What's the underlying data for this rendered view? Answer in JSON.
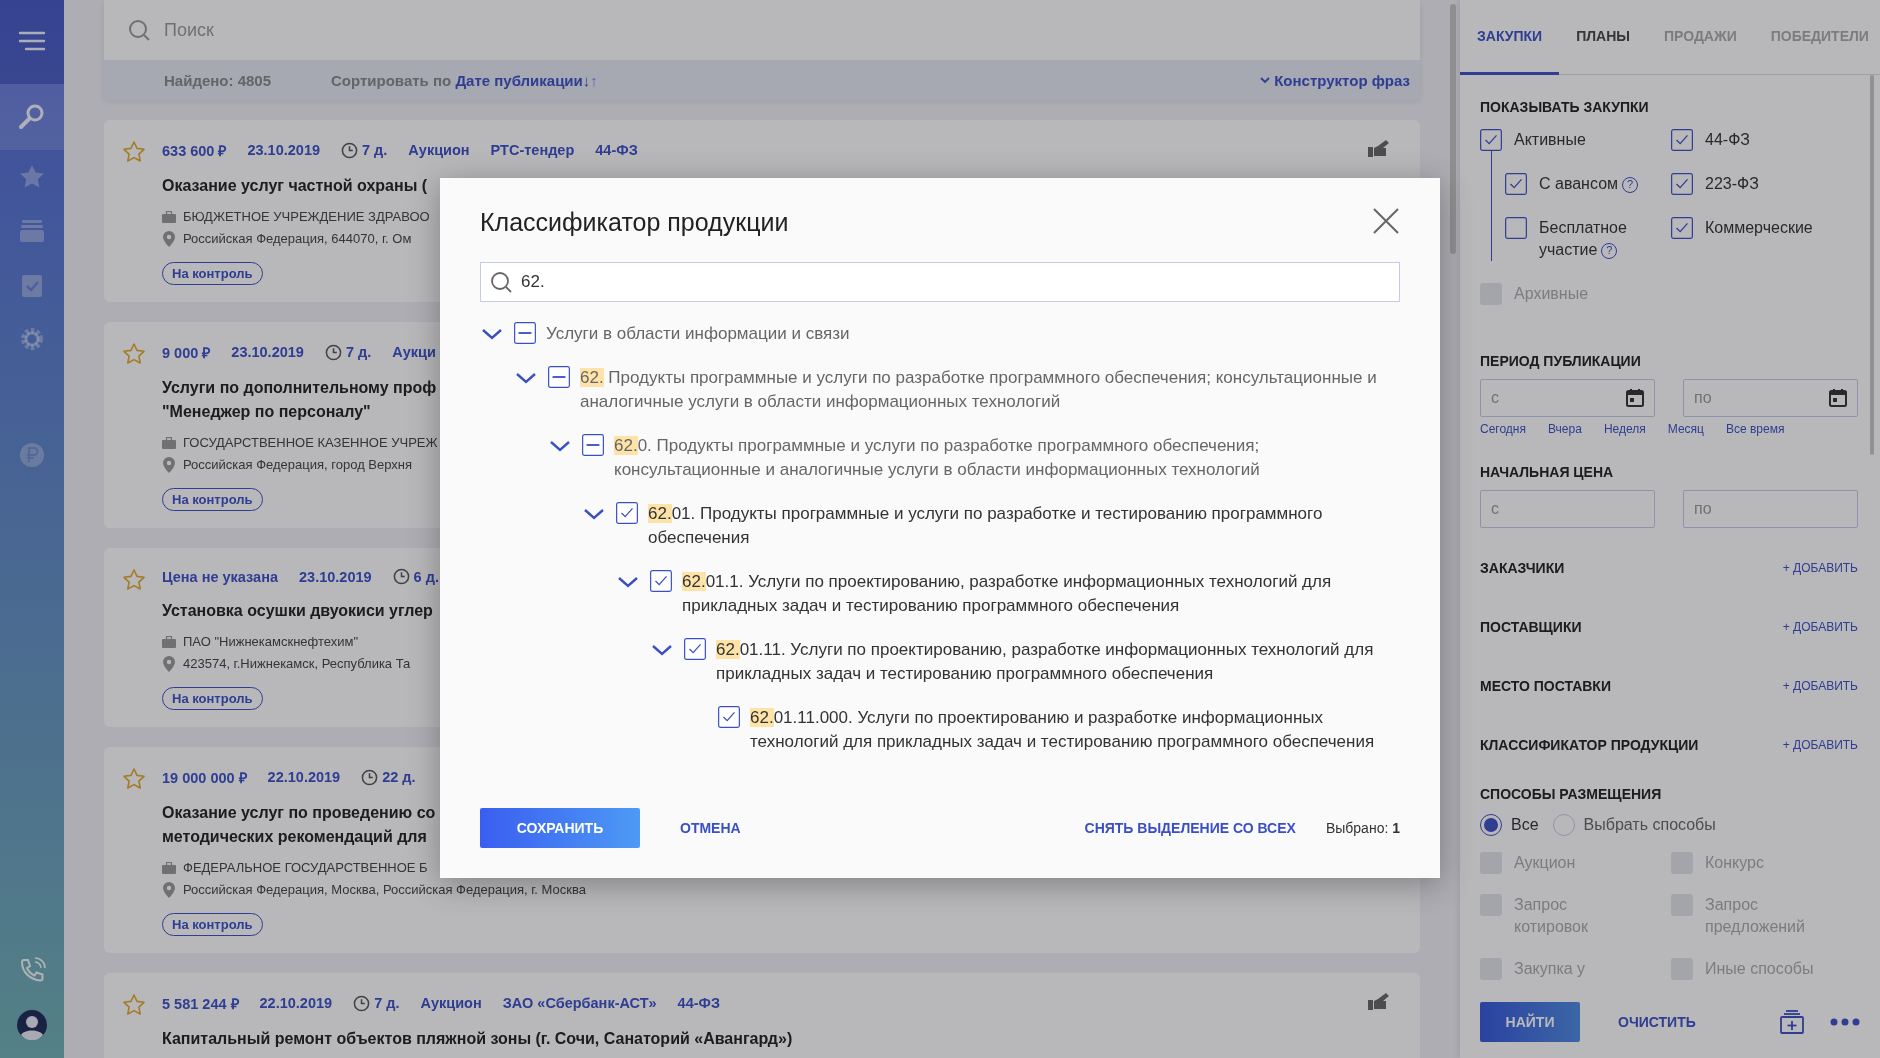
{
  "nav": [
    {
      "kind": "menu",
      "selected": false
    },
    {
      "kind": "search",
      "selected": true
    },
    {
      "kind": "star",
      "selected": false
    },
    {
      "kind": "stack",
      "selected": false
    },
    {
      "kind": "clipboard",
      "selected": false
    },
    {
      "kind": "gear",
      "selected": false
    },
    {
      "kind": "ruble",
      "selected": false
    },
    {
      "kind": "phone",
      "selected": false
    },
    {
      "kind": "avatar",
      "selected": false
    }
  ],
  "search": {
    "placeholder": "Поиск"
  },
  "results_bar": {
    "found": "Найдено: 4805",
    "sort_label": "Сортировать по",
    "sort_value": "Дате публикации↓",
    "sort_alt": "↑",
    "phrase_builder": "Конструктор фраз"
  },
  "cards": [
    {
      "starred": false,
      "price": "633 600 ₽",
      "date": "23.10.2019",
      "days": "7 д.",
      "tags": [
        "Аукцион",
        "РТС-тендер",
        "44-ФЗ"
      ],
      "title_lines": [
        "Оказание услуг частной охраны ("
      ],
      "org": "БЮДЖЕТНОЕ УЧРЕЖДЕНИЕ ЗДРАВОО",
      "address": "Российская Федерация, 644070, г. Ом",
      "button": "На контроль",
      "action_icon": true
    },
    {
      "starred": false,
      "price": "9 000 ₽",
      "date": "23.10.2019",
      "days": "7 д.",
      "tags": [
        "Аукци"
      ],
      "title_lines": [
        "Услуги по дополнительному проф",
        "\"Менеджер по персоналу\""
      ],
      "org": "ГОСУДАРСТВЕННОЕ КАЗЕННОЕ УЧРЕЖ",
      "address": "Российская Федерация, город Верхня",
      "button": "На контроль",
      "action_icon": false
    },
    {
      "starred": false,
      "price": "Цена не указана",
      "date": "23.10.2019",
      "days": "6 д.",
      "title_lines": [
        "Установка осушки двуокиси углер"
      ],
      "org": "ПАО \"Нижнекамскнефтехим\"",
      "address": "423574, г.Нижнекамск, Республика Та",
      "button": "На контроль",
      "action_icon": false
    },
    {
      "starred": false,
      "price": "19 000 000 ₽",
      "date": "22.10.2019",
      "days": "22 д.",
      "title_lines": [
        "Оказание услуг по проведению со",
        "методических рекомендаций для"
      ],
      "org": "ФЕДЕРАЛЬНОЕ ГОСУДАРСТВЕННОЕ Б",
      "address": "Российская Федерация, Москва, Российская Федерация, г. Москва",
      "button": "На контроль",
      "action_icon": false
    },
    {
      "starred": false,
      "price": "5 581 244 ₽",
      "date": "22.10.2019",
      "days": "7 д.",
      "tags": [
        "Аукцион",
        "ЗАО «Сбербанк-АСТ»",
        "44-ФЗ"
      ],
      "title_lines": [
        "Капитальный ремонт объектов пляжной зоны (г. Сочи, Санаторий «Авангард»)"
      ],
      "action_icon": true
    }
  ],
  "filters": {
    "tabs": [
      {
        "label": "ЗАКУПКИ",
        "selected": true,
        "disabled": false
      },
      {
        "label": "ПЛАНЫ",
        "selected": false,
        "disabled": false
      },
      {
        "label": "ПРОДАЖИ",
        "selected": false,
        "disabled": true
      },
      {
        "label": "ПОБЕДИТЕЛИ",
        "selected": false,
        "disabled": true
      }
    ],
    "show": {
      "title": "ПОКАЗЫВАТЬ ЗАКУПКИ",
      "left": [
        {
          "label": "Активные",
          "checked": true,
          "disabled": false,
          "children": [
            {
              "label": "С авансом",
              "checked": true,
              "disabled": false,
              "help": "?"
            },
            {
              "label": "Бесплатное участие",
              "checked": false,
              "disabled": false,
              "help": "?"
            }
          ]
        },
        {
          "label": "Архивные",
          "checked": false,
          "disabled": true
        }
      ],
      "right": [
        {
          "label": "44-ФЗ",
          "checked": true,
          "disabled": false
        },
        {
          "label": "223-ФЗ",
          "checked": true,
          "disabled": false
        },
        {
          "label": "Коммерческие",
          "checked": true,
          "disabled": false
        }
      ]
    },
    "period": {
      "title": "ПЕРИОД ПУБЛИКАЦИИ",
      "from": {
        "placeholder": "с"
      },
      "to": {
        "placeholder": "по"
      },
      "quick": [
        "Сегодня",
        "Вчера",
        "Неделя",
        "Месяц",
        "Все время"
      ]
    },
    "price": {
      "title": "НАЧАЛЬНАЯ ЦЕНА",
      "from": {
        "placeholder": "с"
      },
      "to": {
        "placeholder": "по"
      }
    },
    "add_sections": [
      {
        "title": "ЗАКАЗЧИКИ",
        "action": "+ ДОБАВИТЬ"
      },
      {
        "title": "ПОСТАВЩИКИ",
        "action": "+ ДОБАВИТЬ"
      },
      {
        "title": "МЕСТО ПОСТАВКИ",
        "action": "+ ДОБАВИТЬ"
      },
      {
        "title": "КЛАССИФИКАТОР ПРОДУКЦИИ",
        "action": "+ ДОБАВИТЬ"
      }
    ],
    "methods": {
      "title": "СПОСОБЫ РАЗМЕЩЕНИЯ",
      "radios": [
        {
          "label": "Все",
          "selected": true
        },
        {
          "label": "Выбрать способы",
          "selected": false
        }
      ],
      "options": [
        {
          "label": "Аукцион",
          "checked": false,
          "disabled": true
        },
        {
          "label": "Конкурс",
          "checked": false,
          "disabled": true
        },
        {
          "label": "Запрос котировок",
          "checked": false,
          "disabled": true
        },
        {
          "label": "Запрос предложений",
          "checked": false,
          "disabled": true
        },
        {
          "label": "Закупка у",
          "checked": false,
          "disabled": true
        },
        {
          "label": "Иные способы",
          "checked": false,
          "disabled": true
        }
      ]
    },
    "find": "НАЙТИ",
    "clear": "ОЧИСТИТЬ"
  },
  "modal": {
    "title": "Классификатор продукции",
    "search_value": "62.",
    "tree": [
      {
        "text": "Услуги в области информации и связи",
        "checked": false,
        "indeterminate": true,
        "expanded": true,
        "children": [
          {
            "highlight": "62.",
            "text": " Продукты программные и услуги по разработке программного обеспечения; консультационные и аналогичные услуги в области информационных технологий",
            "checked": false,
            "indeterminate": true,
            "expanded": true,
            "children": [
              {
                "highlight": "62.",
                "text": "0. Продукты программные и услуги по разработке программного обеспечения; консультационные и аналогичные услуги в области информационных технологий",
                "checked": false,
                "indeterminate": true,
                "expanded": true,
                "children": [
                  {
                    "highlight": "62.",
                    "text": "01. Продукты программные и услуги по разработке и тестированию программного обеспечения",
                    "checked": true,
                    "indeterminate": false,
                    "expanded": true,
                    "children": [
                      {
                        "highlight": "62.",
                        "text": "01.1. Услуги по проектированию, разработке информационных технологий для прикладных задач и тестированию программного обеспечения",
                        "checked": true,
                        "indeterminate": false,
                        "expanded": true,
                        "children": [
                          {
                            "highlight": "62.",
                            "text": "01.11. Услуги по проектированию, разработке информационных технологий для прикладных задач и тестированию программного обеспечения",
                            "checked": true,
                            "indeterminate": false,
                            "expanded": true,
                            "children": [
                              {
                                "highlight": "62.",
                                "text": "01.11.000. Услуги по проектированию и разработке информационных технологий для прикладных задач и тестированию программного обеспечения",
                                "checked": true,
                                "indeterminate": false
                              }
                            ]
                          }
                        ]
                      }
                    ]
                  }
                ]
              }
            ]
          }
        ]
      }
    ],
    "save": "СОХРАНИТЬ",
    "cancel": "ОТМЕНА",
    "clear_all": "СНЯТЬ ВЫДЕЛЕНИЕ СО ВСЕХ",
    "selected_count": "Выбрано: **1**"
  }
}
